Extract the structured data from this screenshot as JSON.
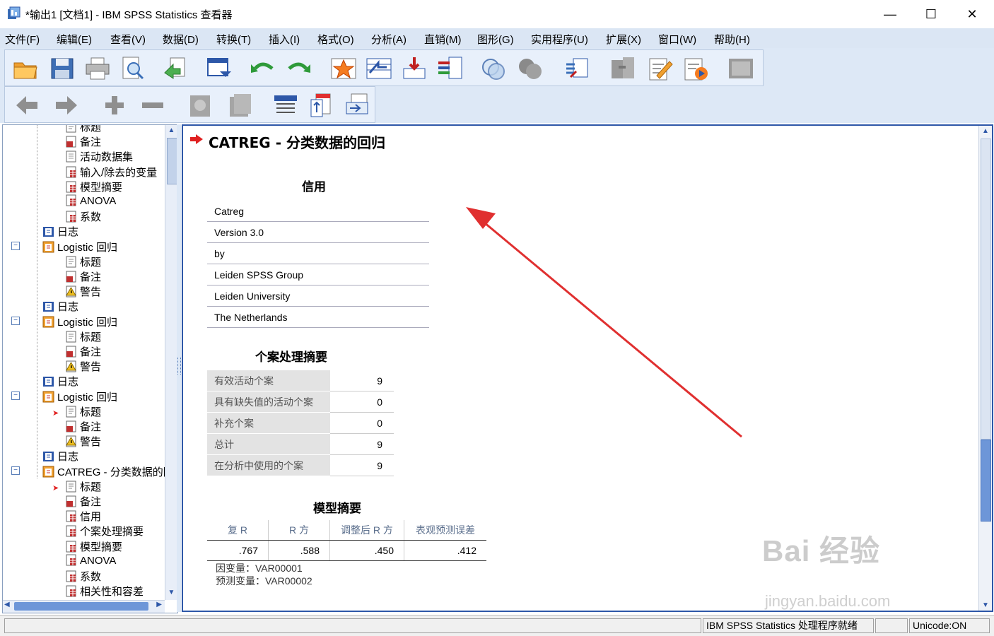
{
  "window": {
    "title": "*输出1 [文档1] - IBM SPSS Statistics 查看器"
  },
  "menu": [
    "文件(F)",
    "编辑(E)",
    "查看(V)",
    "数据(D)",
    "转换(T)",
    "插入(I)",
    "格式(O)",
    "分析(A)",
    "直销(M)",
    "图形(G)",
    "实用程序(U)",
    "扩展(X)",
    "窗口(W)",
    "帮助(H)"
  ],
  "toolbar1": [
    "open-icon",
    "save-icon",
    "print-icon",
    "print-preview-icon",
    "export-icon",
    "recall-dialog-icon",
    "undo-icon",
    "redo-icon",
    "goto-data-icon",
    "goto-case-icon",
    "goto-variable-icon",
    "variables-icon",
    "designate-window-icon",
    "select-icon",
    "script-icon",
    "split-file-icon",
    "edit-icon",
    "run-icon",
    "disabled-icon"
  ],
  "toolbar2": [
    "back-icon",
    "forward-icon",
    "expand-icon",
    "collapse-icon",
    "show-icon",
    "hide-icon",
    "insert-heading-icon",
    "insert-title-icon",
    "insert-text-icon"
  ],
  "outline": [
    {
      "label": "标题",
      "level": 2,
      "icon": "title"
    },
    {
      "label": "备注",
      "level": 2,
      "icon": "notes"
    },
    {
      "label": "活动数据集",
      "level": 2,
      "icon": "text"
    },
    {
      "label": "输入/除去的变量",
      "level": 2,
      "icon": "table"
    },
    {
      "label": "模型摘要",
      "level": 2,
      "icon": "table"
    },
    {
      "label": "ANOVA",
      "level": 2,
      "icon": "table"
    },
    {
      "label": "系数",
      "level": 2,
      "icon": "table"
    },
    {
      "label": "日志",
      "level": 1,
      "icon": "log"
    },
    {
      "label": "Logistic 回归",
      "level": 1,
      "icon": "proc",
      "toggle": true
    },
    {
      "label": "标题",
      "level": 2,
      "icon": "title"
    },
    {
      "label": "备注",
      "level": 2,
      "icon": "notes"
    },
    {
      "label": "警告",
      "level": 2,
      "icon": "warn"
    },
    {
      "label": "日志",
      "level": 1,
      "icon": "log"
    },
    {
      "label": "Logistic 回归",
      "level": 1,
      "icon": "proc",
      "toggle": true
    },
    {
      "label": "标题",
      "level": 2,
      "icon": "title"
    },
    {
      "label": "备注",
      "level": 2,
      "icon": "notes"
    },
    {
      "label": "警告",
      "level": 2,
      "icon": "warn"
    },
    {
      "label": "日志",
      "level": 1,
      "icon": "log"
    },
    {
      "label": "Logistic 回归",
      "level": 1,
      "icon": "proc",
      "toggle": true
    },
    {
      "label": "标题",
      "level": 2,
      "icon": "title",
      "current": true
    },
    {
      "label": "备注",
      "level": 2,
      "icon": "notes"
    },
    {
      "label": "警告",
      "level": 2,
      "icon": "warn"
    },
    {
      "label": "日志",
      "level": 1,
      "icon": "log"
    },
    {
      "label": "CATREG - 分类数据的回归",
      "level": 1,
      "icon": "proc",
      "toggle": true
    },
    {
      "label": "标题",
      "level": 2,
      "icon": "title",
      "current": true
    },
    {
      "label": "备注",
      "level": 2,
      "icon": "notes"
    },
    {
      "label": "信用",
      "level": 2,
      "icon": "table"
    },
    {
      "label": "个案处理摘要",
      "level": 2,
      "icon": "table"
    },
    {
      "label": "模型摘要",
      "level": 2,
      "icon": "table"
    },
    {
      "label": "ANOVA",
      "level": 2,
      "icon": "table"
    },
    {
      "label": "系数",
      "level": 2,
      "icon": "table"
    },
    {
      "label": "相关性和容差",
      "level": 2,
      "icon": "table"
    }
  ],
  "output": {
    "heading": "CATREG - 分类数据的回归",
    "credit_caption": "信用",
    "credit_rows": [
      "Catreg",
      "Version 3.0",
      "by",
      "Leiden SPSS Group",
      "Leiden University",
      "The Netherlands"
    ],
    "case_caption": "个案处理摘要",
    "case_rows": [
      {
        "label": "有效活动个案",
        "value": "9"
      },
      {
        "label": "具有缺失值的活动个案",
        "value": "0"
      },
      {
        "label": "补充个案",
        "value": "0"
      },
      {
        "label": "总计",
        "value": "9"
      },
      {
        "label": "在分析中使用的个案",
        "value": "9"
      }
    ],
    "model_caption": "模型摘要",
    "model_headers": [
      "复 R",
      "R 方",
      "调整后 R 方",
      "表观预测误差"
    ],
    "model_values": [
      ".767",
      ".588",
      ".450",
      ".412"
    ],
    "model_footnote1": "因变量：VAR00001",
    "model_footnote2": "预测变量：VAR00002"
  },
  "status": {
    "processor": "IBM SPSS Statistics 处理程序就绪",
    "unicode": "Unicode:ON"
  },
  "watermark": {
    "brand": "Bai 经验",
    "url": "jingyan.baidu.com"
  },
  "colors": {
    "menubar": "#dbe6f4",
    "selection_border": "#2d57a8",
    "arrow": "#e02020"
  }
}
